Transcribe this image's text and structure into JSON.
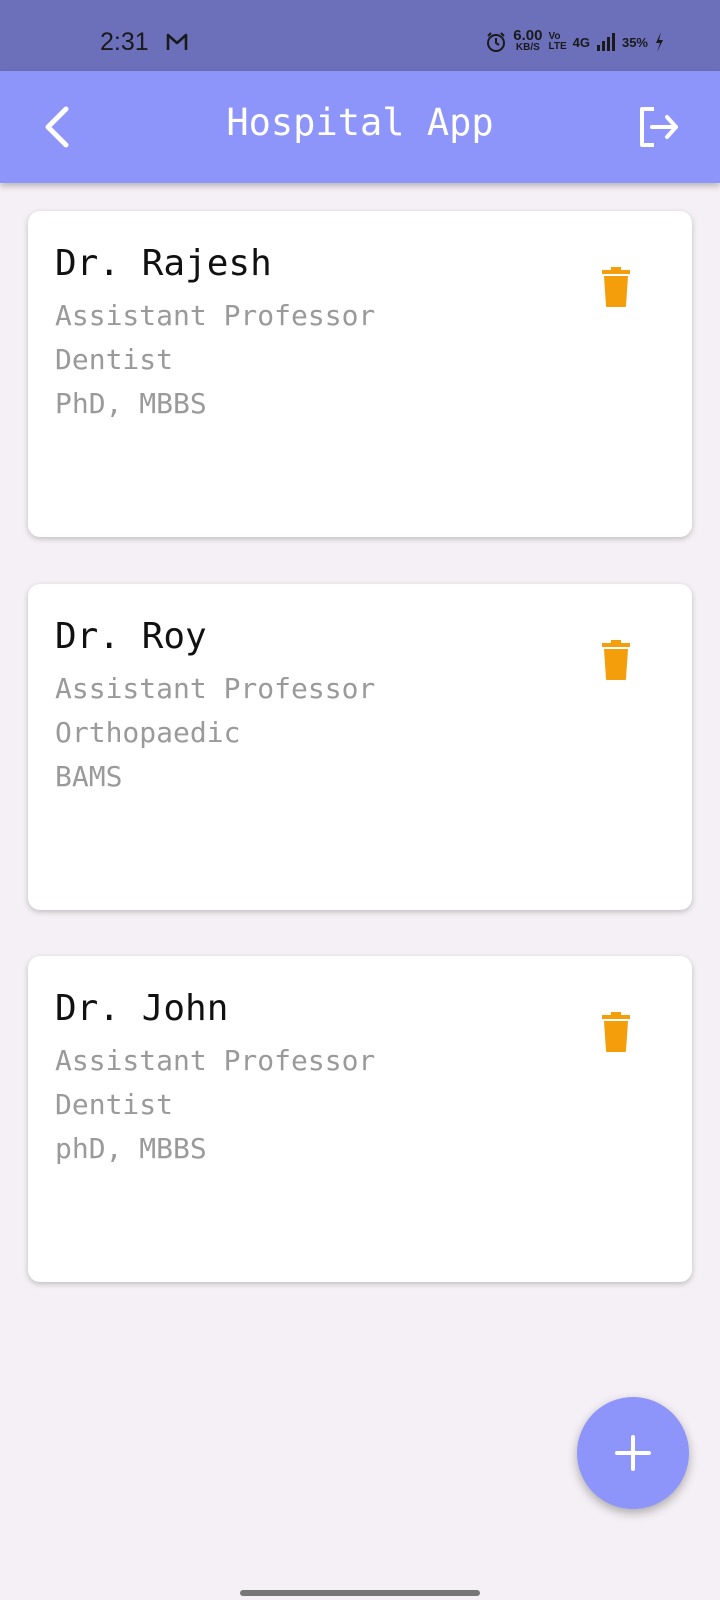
{
  "status_bar": {
    "time": "2:31",
    "speed_value": "6.00",
    "speed_unit": "KB/S",
    "volte_top": "Vo",
    "volte_bottom": "LTE",
    "network": "4G",
    "battery": "35%"
  },
  "app_bar": {
    "title": "Hospital App"
  },
  "doctors": [
    {
      "name": "Dr. Rajesh",
      "designation": "Assistant Professor",
      "specialty": "Dentist",
      "qualification": "PhD, MBBS"
    },
    {
      "name": "Dr. Roy",
      "designation": "Assistant Professor",
      "specialty": "Orthopaedic",
      "qualification": "BAMS"
    },
    {
      "name": "Dr. John",
      "designation": "Assistant Professor",
      "specialty": "Dentist",
      "qualification": "phD, MBBS"
    }
  ],
  "icons": {
    "back": "chevron-left-icon",
    "logout": "logout-icon",
    "delete": "trash-icon",
    "add": "plus-icon"
  },
  "colors": {
    "status_bar": "#6c70bb",
    "app_bar": "#8d94fa",
    "delete_icon": "#f59e0b",
    "fab": "#8d94fa"
  }
}
